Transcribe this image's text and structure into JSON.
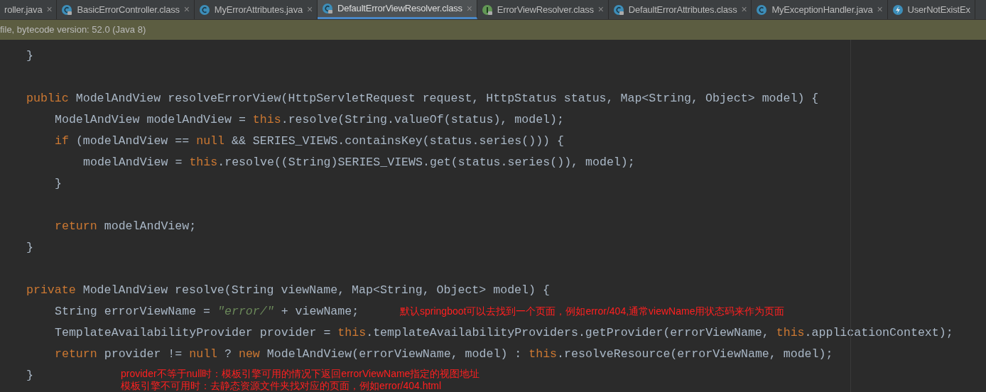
{
  "tabs": [
    {
      "label": "roller.java",
      "kind": "none",
      "locked": false,
      "selected": false,
      "close": "×"
    },
    {
      "label": "BasicErrorController.class",
      "kind": "class",
      "locked": true,
      "selected": false,
      "close": "×"
    },
    {
      "label": "MyErrorAttributes.java",
      "kind": "class",
      "locked": false,
      "selected": false,
      "close": "×"
    },
    {
      "label": "DefaultErrorViewResolver.class",
      "kind": "class",
      "locked": true,
      "selected": true,
      "close": "×"
    },
    {
      "label": "ErrorViewResolver.class",
      "kind": "interface",
      "locked": true,
      "selected": false,
      "close": "×"
    },
    {
      "label": "DefaultErrorAttributes.class",
      "kind": "class",
      "locked": true,
      "selected": false,
      "close": "×"
    },
    {
      "label": "MyExceptionHandler.java",
      "kind": "class",
      "locked": false,
      "selected": false,
      "close": "×"
    },
    {
      "label": "UserNotExistEx",
      "kind": "exception",
      "locked": false,
      "selected": false
    }
  ],
  "banner": {
    "text": "file, bytecode version: 52.0 (Java 8)"
  },
  "code_lines": [
    {
      "kind": "code",
      "tokens": [
        {
          "kind": "plain",
          "text": "}"
        }
      ]
    },
    {
      "kind": "blank"
    },
    {
      "kind": "code",
      "tokens": [
        {
          "kind": "kw",
          "text": "public "
        },
        {
          "kind": "plain",
          "text": "ModelAndView resolveErrorView(HttpServletRequest request, HttpStatus status, Map<String, Object> model) {"
        }
      ],
      "children": [
        {
          "kind": "code",
          "tokens": [
            {
              "kind": "plain",
              "text": "ModelAndView modelAndView = "
            },
            {
              "kind": "kw",
              "text": "this"
            },
            {
              "kind": "plain",
              "text": ".resolve(String.valueOf(status), model);"
            }
          ]
        },
        {
          "kind": "code",
          "tokens": [
            {
              "kind": "kw",
              "text": "if "
            },
            {
              "kind": "plain",
              "text": "(modelAndView == "
            },
            {
              "kind": "kw",
              "text": "null "
            },
            {
              "kind": "plain",
              "text": "&& SERIES_VIEWS.containsKey(status.series())) {"
            }
          ],
          "children": [
            {
              "kind": "code",
              "tokens": [
                {
                  "kind": "plain",
                  "text": "modelAndView = "
                },
                {
                  "kind": "kw",
                  "text": "this"
                },
                {
                  "kind": "plain",
                  "text": ".resolve((String)SERIES_VIEWS.get(status.series()), model);"
                }
              ]
            }
          ]
        },
        {
          "kind": "code",
          "tokens": [
            {
              "kind": "plain",
              "text": "}"
            }
          ]
        },
        {
          "kind": "blank"
        },
        {
          "kind": "code",
          "tokens": [
            {
              "kind": "kw",
              "text": "return "
            },
            {
              "kind": "plain",
              "text": "modelAndView;"
            }
          ]
        }
      ]
    },
    {
      "kind": "code",
      "tokens": [
        {
          "kind": "plain",
          "text": "}"
        }
      ]
    },
    {
      "kind": "blank"
    },
    {
      "kind": "code",
      "tokens": [
        {
          "kind": "kw",
          "text": "private "
        },
        {
          "kind": "plain",
          "text": "ModelAndView resolve(String viewName, Map<String, Object> model) {"
        }
      ],
      "children": [
        {
          "kind": "code",
          "tokens": [
            {
              "kind": "plain",
              "text": "String errorViewName = "
            },
            {
              "kind": "str",
              "text": "\"error/\""
            },
            {
              "kind": "plain",
              "text": " + viewName;"
            }
          ]
        },
        {
          "kind": "code",
          "tokens": [
            {
              "kind": "plain",
              "text": "TemplateAvailabilityProvider provider = "
            },
            {
              "kind": "kw",
              "text": "this"
            },
            {
              "kind": "plain",
              "text": ".templateAvailabilityProviders.getProvider(errorViewName, "
            },
            {
              "kind": "kw",
              "text": "this"
            },
            {
              "kind": "plain",
              "text": ".applicationContext);"
            }
          ]
        },
        {
          "kind": "code",
          "tokens": [
            {
              "kind": "kw",
              "text": "return "
            },
            {
              "kind": "plain",
              "text": "provider != "
            },
            {
              "kind": "kw",
              "text": "null "
            },
            {
              "kind": "plain",
              "text": "? "
            },
            {
              "kind": "kw",
              "text": "new "
            },
            {
              "kind": "plain",
              "text": "ModelAndView(errorViewName, model) : "
            },
            {
              "kind": "kw",
              "text": "this"
            },
            {
              "kind": "plain",
              "text": ".resolveResource(errorViewName, model);"
            }
          ]
        }
      ]
    },
    {
      "kind": "code",
      "tokens": [
        {
          "kind": "plain",
          "text": "}"
        }
      ]
    }
  ],
  "annotations": [
    "默认springboot可以去找到一个页面，例如error/404,通常viewName用状态码来作为页面",
    "provider不等于null时：模板引擎可用的情况下返回errorViewName指定的视图地址",
    "模板引擎不可用时：去静态资源文件夹找对应的页面，例如error/404.html"
  ]
}
